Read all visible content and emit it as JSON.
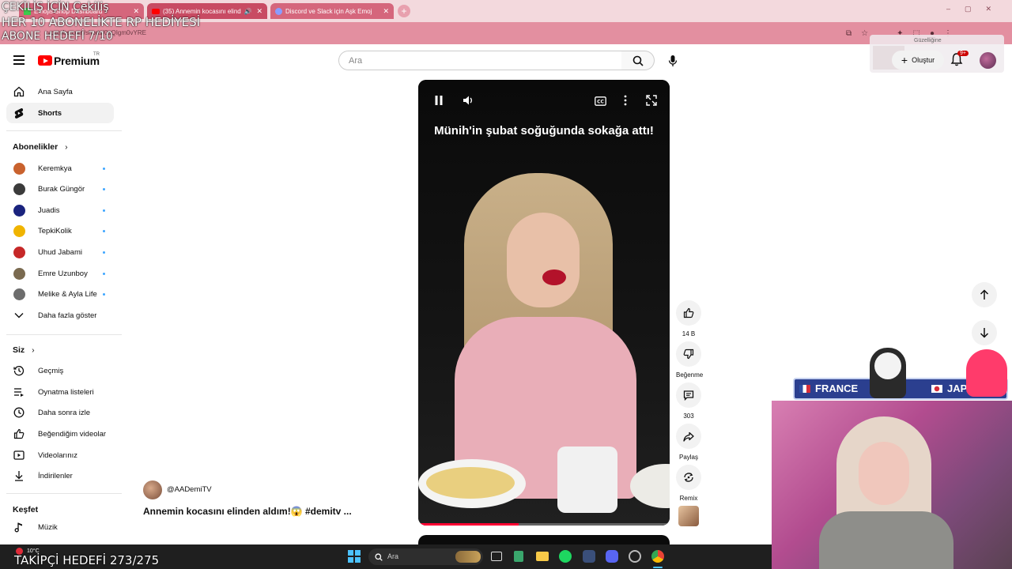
{
  "overlay": {
    "line1": "ÇEKİLİŞ İÇİN Çekiliş",
    "line2": "HER 10 ABONELİKTE RP HEDİYESİ",
    "line3": "ABONE HEDEFİ 7/10",
    "follower_goal": "TAKİPÇİ HEDEFİ 273/275",
    "cam_left_label": "FRANCE",
    "cam_right_label": "JAPAN"
  },
  "browser": {
    "tabs": [
      {
        "title": "Emojis Shop Dashboard",
        "active": false
      },
      {
        "title": "(35) Annemin kocasını elind",
        "active": true
      },
      {
        "title": "Discord ve Slack için Aşk Emoj",
        "active": false
      }
    ],
    "url": "youtube.com/shorts/0sQIgm0vYRE"
  },
  "header": {
    "logo": "Premium",
    "logo_sup": "TR",
    "search_placeholder": "Ara",
    "create_label": "Oluştur",
    "notif_count": "9+",
    "popup_title": "Güzelliğine"
  },
  "sidebar": {
    "main": [
      {
        "label": "Ana Sayfa",
        "icon": "home-icon"
      },
      {
        "label": "Shorts",
        "icon": "shorts-icon",
        "active": true
      }
    ],
    "subs_title": "Abonelikler",
    "subs": [
      {
        "label": "Keremkya",
        "color": "#c9622e"
      },
      {
        "label": "Burak Güngör",
        "color": "#3b3b3b"
      },
      {
        "label": "Juadis",
        "color": "#1a237e"
      },
      {
        "label": "TepkiKolik",
        "color": "#f0b400"
      },
      {
        "label": "Uhud Jabami",
        "color": "#c62828"
      },
      {
        "label": "Emre Uzunboy",
        "color": "#7a6a50"
      },
      {
        "label": "Melike & Ayla Life",
        "color": "#6d6d6d"
      }
    ],
    "more": "Daha fazla göster",
    "you_title": "Siz",
    "you": [
      {
        "label": "Geçmiş",
        "icon": "history-icon"
      },
      {
        "label": "Oynatma listeleri",
        "icon": "playlist-icon"
      },
      {
        "label": "Daha sonra izle",
        "icon": "clock-icon"
      },
      {
        "label": "Beğendiğim videolar",
        "icon": "thumbs-up-icon"
      },
      {
        "label": "Videolarınız",
        "icon": "video-icon"
      },
      {
        "label": "İndirilenler",
        "icon": "download-icon"
      }
    ],
    "explore_title": "Keşfet",
    "explore": [
      {
        "label": "Müzik",
        "icon": "music-icon"
      }
    ]
  },
  "short": {
    "caption": "Münih'in şubat soğuğunda sokağa attı!",
    "channel": "@AADemiTV",
    "title": "Annemin kocasını elinden aldım!😱 #demitv ...",
    "likes": "14 B",
    "dislike_label": "Beğenme",
    "comments": "303",
    "share_label": "Paylaş",
    "remix_label": "Remix",
    "progress": 0.4
  },
  "taskbar": {
    "weather": "10°C",
    "search_placeholder": "Ara"
  }
}
